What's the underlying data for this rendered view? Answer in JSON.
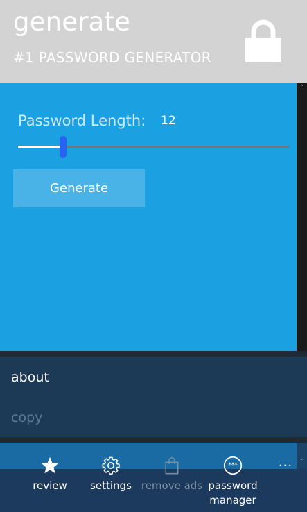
{
  "header": {
    "title": "generate",
    "subtitle": "#1 PASSWORD GENERATOR",
    "icon": "lock-icon",
    "background": "#d3d3d3"
  },
  "generator": {
    "length_label": "Password Length:",
    "length_value": "12",
    "slider_fraction": 0.165,
    "button_label": "Generate",
    "accent": "#1ba0e1",
    "thumb_color": "#2563f0"
  },
  "menu": {
    "items": [
      {
        "label": "about",
        "enabled": true
      },
      {
        "label": "copy",
        "enabled": false
      }
    ]
  },
  "appbar": {
    "buttons": [
      {
        "label": "review",
        "icon": "star-icon",
        "enabled": true
      },
      {
        "label": "settings",
        "icon": "gear-icon",
        "enabled": true
      },
      {
        "label": "remove ads",
        "icon": "shopping-bag-icon",
        "enabled": false
      },
      {
        "label": "password manager",
        "icon": "password-dots-icon",
        "enabled": true
      }
    ],
    "more": "..."
  }
}
